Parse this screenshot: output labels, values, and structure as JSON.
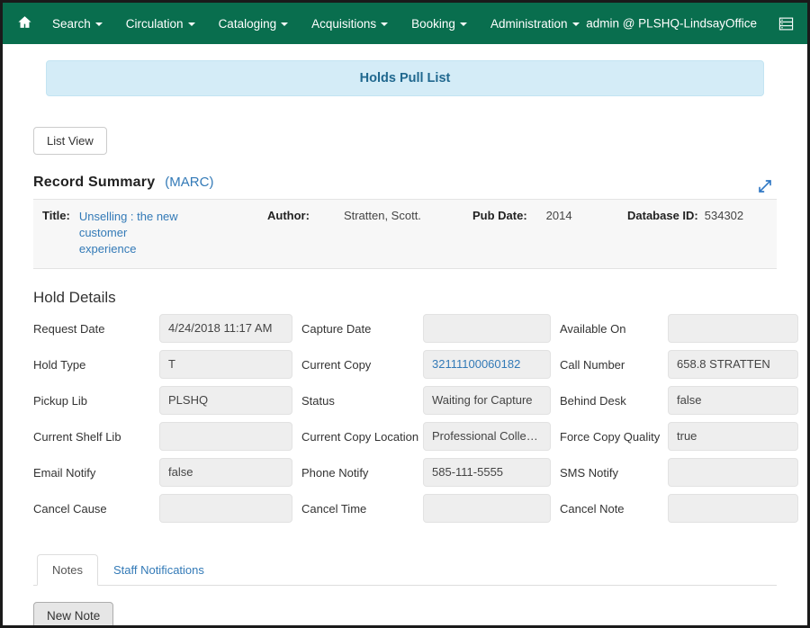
{
  "window": {
    "frame_border_color": "#1a1a1a"
  },
  "navbar": {
    "background": "#096e4e",
    "home_icon": "home-icon",
    "items": [
      {
        "label": "Search",
        "has_caret": true
      },
      {
        "label": "Circulation",
        "has_caret": true
      },
      {
        "label": "Cataloging",
        "has_caret": true
      },
      {
        "label": "Acquisitions",
        "has_caret": true
      },
      {
        "label": "Booking",
        "has_caret": true
      },
      {
        "label": "Administration",
        "has_caret": true
      }
    ],
    "user": "admin @ PLSHQ-LindsayOffice",
    "grid_icon": "list-grid-icon"
  },
  "banner": {
    "text": "Holds Pull List",
    "background": "#d4ecf7",
    "text_color": "#20688f"
  },
  "toolbar": {
    "list_view_label": "List View"
  },
  "record_summary": {
    "heading": "Record Summary",
    "marc_link": "(MARC)",
    "expand_icon": "expand-diagonal-icon",
    "fields": [
      {
        "label": "Title:",
        "value": "Unselling : the new customer experience",
        "is_link": true
      },
      {
        "label": "Author:",
        "value": "Stratten, Scott.",
        "is_link": false
      },
      {
        "label": "Pub Date:",
        "value": "2014",
        "is_link": false
      },
      {
        "label": "Database ID:",
        "value": "534302",
        "is_link": false
      }
    ]
  },
  "hold_details": {
    "heading": "Hold Details",
    "rows": [
      [
        {
          "label": "Request Date",
          "value": "4/24/2018 11:17 AM",
          "is_link": false
        },
        {
          "label": "Capture Date",
          "value": "",
          "is_link": false
        },
        {
          "label": "Available On",
          "value": "",
          "is_link": false
        }
      ],
      [
        {
          "label": "Hold Type",
          "value": "T",
          "is_link": false
        },
        {
          "label": "Current Copy",
          "value": "32111100060182",
          "is_link": true
        },
        {
          "label": "Call Number",
          "value": "658.8 STRATTEN",
          "is_link": false
        }
      ],
      [
        {
          "label": "Pickup Lib",
          "value": "PLSHQ",
          "is_link": false
        },
        {
          "label": "Status",
          "value": "Waiting for Capture",
          "is_link": false
        },
        {
          "label": "Behind Desk",
          "value": "false",
          "is_link": false
        }
      ],
      [
        {
          "label": "Current Shelf Lib",
          "value": "",
          "is_link": false
        },
        {
          "label": "Current Copy Location",
          "value": "Professional Collection",
          "is_link": false
        },
        {
          "label": "Force Copy Quality",
          "value": "true",
          "is_link": false
        }
      ],
      [
        {
          "label": "Email Notify",
          "value": "false",
          "is_link": false
        },
        {
          "label": "Phone Notify",
          "value": "585-111-5555",
          "is_link": false
        },
        {
          "label": "SMS Notify",
          "value": "",
          "is_link": false
        }
      ],
      [
        {
          "label": "Cancel Cause",
          "value": "",
          "is_link": false
        },
        {
          "label": "Cancel Time",
          "value": "",
          "is_link": false
        },
        {
          "label": "Cancel Note",
          "value": "",
          "is_link": false
        }
      ]
    ]
  },
  "tabs": [
    {
      "label": "Notes",
      "active": true
    },
    {
      "label": "Staff Notifications",
      "active": false
    }
  ],
  "actions": {
    "new_note_label": "New Note"
  }
}
